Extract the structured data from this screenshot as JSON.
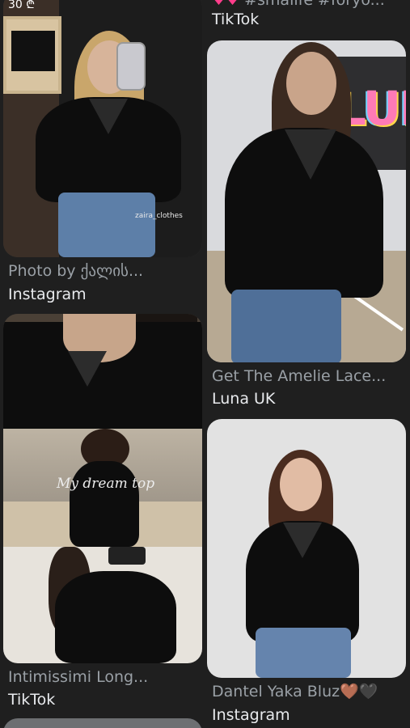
{
  "top_partial": {
    "price": "30 ₾",
    "right_caption": "#smallfe #foryo...",
    "right_source": "TikTok"
  },
  "left_column": [
    {
      "caption": "Photo by ქალის...",
      "source": "Instagram",
      "watermark": "zaira_clothes"
    },
    {
      "caption": "Intimissimi Long...",
      "source": "TikTok",
      "overlay_text": "My dream top"
    }
  ],
  "right_column": [
    {
      "caption": "Get The Amelie Lace...",
      "source": "Luna UK",
      "sign_text": "LUN"
    },
    {
      "caption": "Dantel Yaka Bluz",
      "caption_emoji": "🤎🖤",
      "source": "Instagram"
    }
  ],
  "colors": {
    "background": "#1f1f1f",
    "caption": "#9aa0a6",
    "source": "#e8eaed"
  },
  "icons": [
    "heart-emoji-icon"
  ]
}
